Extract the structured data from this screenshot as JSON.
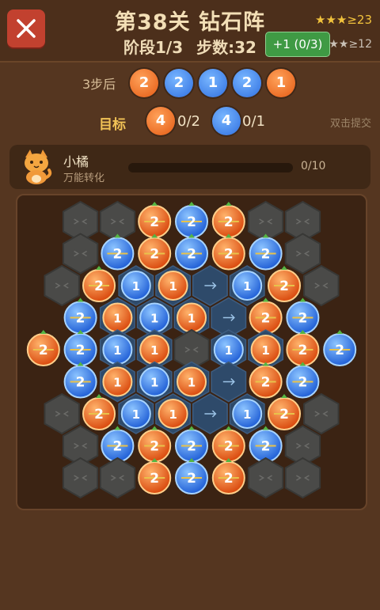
{
  "header": {
    "title": "第38关 钻石阵",
    "stage": "阶段1/3",
    "steps": "步数:32",
    "plus_button": "+1 (0/3)",
    "stars_top": "★★★≥23",
    "stars_bottom": "★★≥12"
  },
  "forecast": {
    "label": "3步后",
    "balls": [
      {
        "color": "orange",
        "value": "2"
      },
      {
        "color": "blue",
        "value": "2"
      },
      {
        "color": "blue",
        "value": "1"
      },
      {
        "color": "blue",
        "value": "2"
      },
      {
        "color": "orange",
        "value": "1"
      }
    ]
  },
  "goals": {
    "label": "目标",
    "items": [
      {
        "color": "orange",
        "value": "4",
        "count": "0/2"
      },
      {
        "color": "blue",
        "value": "4",
        "count": "0/1"
      }
    ],
    "hint": "双击提交"
  },
  "helper": {
    "name": "小橘",
    "ability": "万能转化",
    "progress": "0/10",
    "progress_fraction": 0
  },
  "board": {
    "rows": [
      "XXoboXX",
      "XbobobX",
      "XoBOABoX",
      "bOBOAob",
      "obBOXBOob",
      "bOBOAob",
      "XoBOABoX",
      "XbobobX",
      "XXoboXX"
    ],
    "legend": {
      "X": "locked",
      "o": "orange-2",
      "b": "blue-2",
      "O": "orange-1",
      "B": "blue-1",
      "A": "arrow-empty"
    }
  },
  "colors": {
    "orange": "#e8611b",
    "blue": "#2f72e4",
    "background": "#553620"
  }
}
